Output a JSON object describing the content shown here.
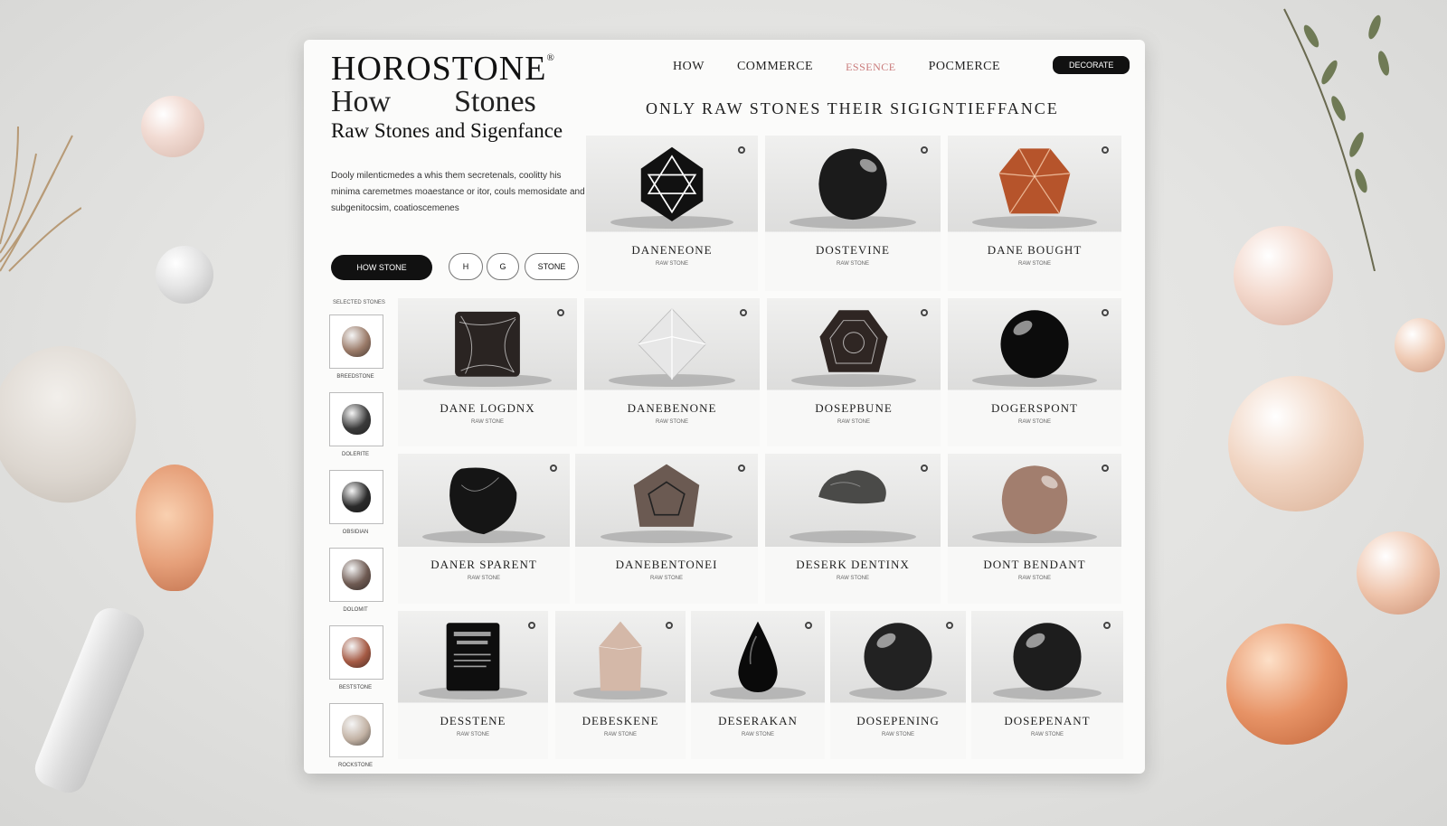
{
  "brand": {
    "name": "HOROSTONE",
    "mark": "®"
  },
  "header": {
    "subtitle_left": "How",
    "subtitle_right": "Stones",
    "subtitle_line2": "Raw Stones and Sigenfance",
    "tagline": "ONLY  RAW STONES  THEIR SIGIGNTIEFFANCE"
  },
  "nav": {
    "items": [
      "HOW",
      "COMMERCE",
      "ESSENCE",
      "POCMERCE"
    ],
    "button_label": "DECORATE"
  },
  "intro": {
    "description": "Dooly milenticmedes a whis them secretenals, coolitty his minima caremetmes moaestance or itor, couls memosidate and subgenitocsim, coatioscemenes",
    "cta_label": "HOW STONE",
    "pills": [
      "H",
      "G",
      "STONE"
    ]
  },
  "thumbnails": {
    "heading": "SELECTED STONES",
    "items": [
      {
        "label": "BREEDSTONE",
        "color": "#9a7a68"
      },
      {
        "label": "DOLERITE",
        "color": "#3a3a3a"
      },
      {
        "label": "OBSIDIAN",
        "color": "#2a2a2a"
      },
      {
        "label": "DOLOMIT",
        "color": "#6e5a52"
      },
      {
        "label": "BESTSTONE",
        "color": "#a55a44"
      },
      {
        "label": "ROCKSTONE",
        "color": "#c2b2a4"
      }
    ]
  },
  "cards": [
    {
      "name": "DANENEONE",
      "caption": "RAW STONE",
      "shape": "star",
      "color": "#111111"
    },
    {
      "name": "DOSTEVINE",
      "caption": "RAW STONE",
      "shape": "round",
      "color": "#1b1b1b"
    },
    {
      "name": "DANE BOUGHT",
      "caption": "RAW STONE",
      "shape": "facet",
      "color": "#b6542b"
    },
    {
      "name": "DANE LOGDNX",
      "caption": "RAW STONE",
      "shape": "cube",
      "color": "#2a2422"
    },
    {
      "name": "DANEBENONE",
      "caption": "RAW STONE",
      "shape": "diamond",
      "color": "#d9d9d9"
    },
    {
      "name": "DOSEPBUNE",
      "caption": "RAW STONE",
      "shape": "hex",
      "color": "#2f2623"
    },
    {
      "name": "DOGERSPONT",
      "caption": "RAW STONE",
      "shape": "sphere",
      "color": "#0c0c0c"
    },
    {
      "name": "DANER SPARENT",
      "caption": "RAW STONE",
      "shape": "pillow",
      "color": "#151515"
    },
    {
      "name": "DANEBENTONEI",
      "caption": "RAW STONE",
      "shape": "dodeca",
      "color": "#6b5a52"
    },
    {
      "name": "DESERK DENTINX",
      "caption": "RAW STONE",
      "shape": "raw",
      "color": "#4a4a48"
    },
    {
      "name": "DONT BENDANT",
      "caption": "RAW STONE",
      "shape": "round",
      "color": "#a27e6e"
    },
    {
      "name": "DESSTENE",
      "caption": "RAW STONE",
      "shape": "block",
      "color": "#0e0e0e"
    },
    {
      "name": "DEBESKENE",
      "caption": "RAW STONE",
      "shape": "point",
      "color": "#d4b8a8"
    },
    {
      "name": "DESERAKAN",
      "caption": "RAW STONE",
      "shape": "drop",
      "color": "#0a0a0a"
    },
    {
      "name": "DOSEPENING",
      "caption": "RAW STONE",
      "shape": "sphere",
      "color": "#222222"
    },
    {
      "name": "DOSEPENANT",
      "caption": "RAW STONE",
      "shape": "hexround",
      "color": "#1d1d1d"
    }
  ]
}
